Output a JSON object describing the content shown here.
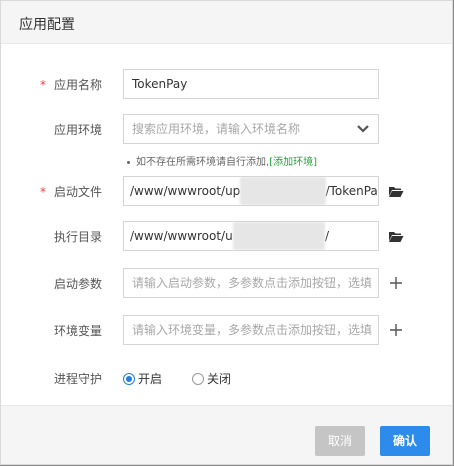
{
  "dialog": {
    "title": "应用配置"
  },
  "form": {
    "app_name": {
      "label": "应用名称",
      "value": "TokenPay"
    },
    "app_env": {
      "label": "应用环境",
      "placeholder": "搜索应用环境，请输入环境名称",
      "hint_text": "如不存在所需环境请自行添加,",
      "hint_link": "[添加环境]"
    },
    "startup_file": {
      "label": "启动文件",
      "value_prefix": "/www/wwwroot/up",
      "value_blurred": "xxxxxxxxxxxx",
      "value_suffix": "/TokenPay"
    },
    "exec_dir": {
      "label": "执行目录",
      "value_prefix": "/www/wwwroot/u",
      "value_blurred": "xxxxxxxxxxxxx",
      "value_suffix": "/"
    },
    "startup_params": {
      "label": "启动参数",
      "placeholder": "请输入启动参数，多参数点击添加按钮，选填"
    },
    "env_vars": {
      "label": "环境变量",
      "placeholder": "请输入环境变量，多参数点击添加按钮，选填"
    },
    "daemon": {
      "label": "进程守护",
      "options": [
        "开启",
        "关闭"
      ],
      "selected": "开启"
    }
  },
  "footer": {
    "cancel_label": "取消",
    "ok_label": "确认"
  },
  "colors": {
    "accent": "#2d8ceb",
    "link": "#20a53a",
    "required": "#ef3f3f"
  }
}
